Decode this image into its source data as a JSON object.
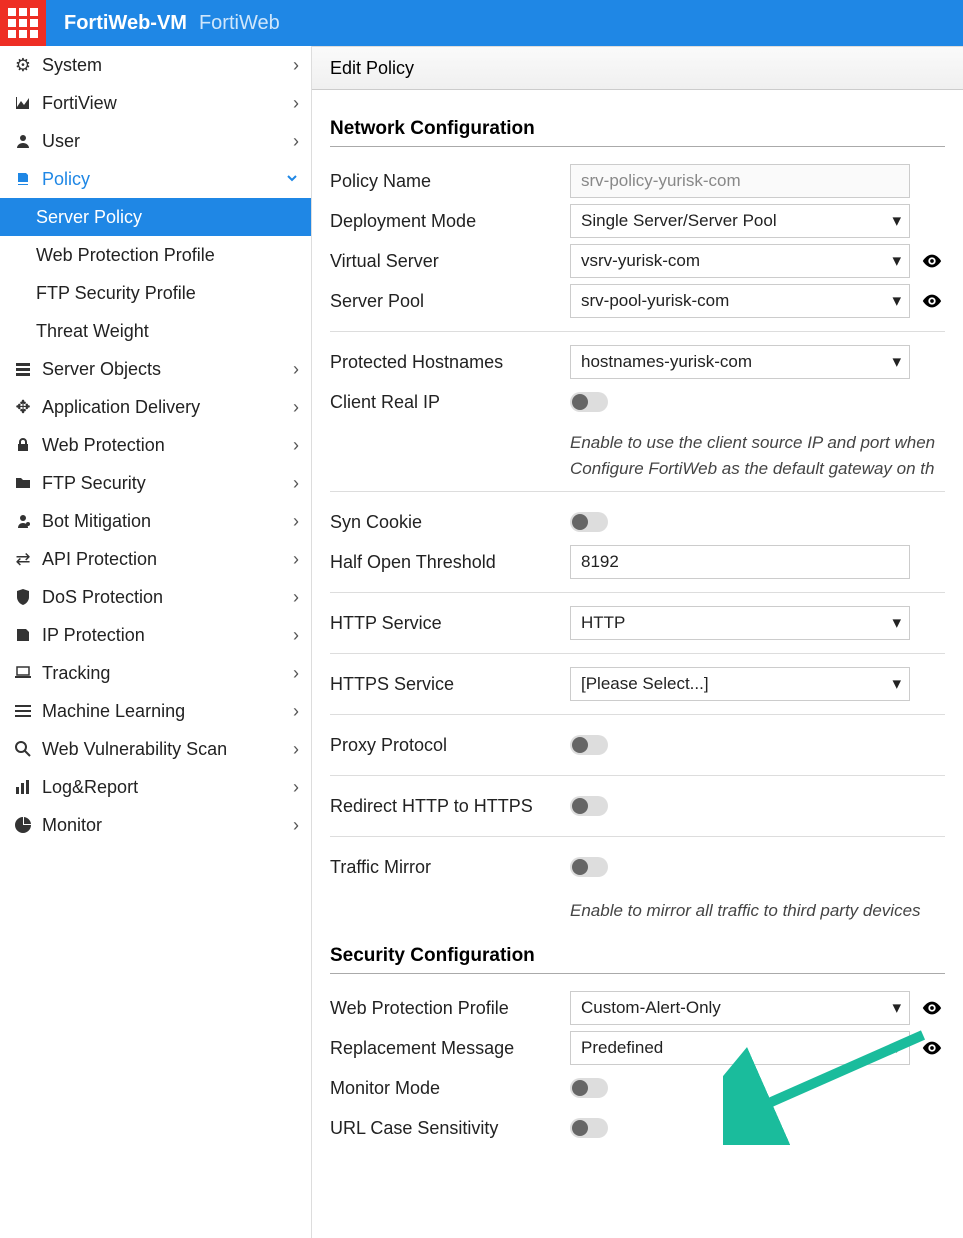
{
  "header": {
    "app": "FortiWeb-VM",
    "sub": "FortiWeb"
  },
  "sidebar": {
    "items": [
      {
        "label": "System",
        "icon": "gear"
      },
      {
        "label": "FortiView",
        "icon": "area"
      },
      {
        "label": "User",
        "icon": "user"
      },
      {
        "label": "Policy",
        "icon": "policy",
        "active": true,
        "expanded": true,
        "children": [
          {
            "label": "Server Policy",
            "selected": true
          },
          {
            "label": "Web Protection Profile"
          },
          {
            "label": "FTP Security Profile"
          },
          {
            "label": "Threat Weight"
          }
        ]
      },
      {
        "label": "Server Objects",
        "icon": "servers"
      },
      {
        "label": "Application Delivery",
        "icon": "move"
      },
      {
        "label": "Web Protection",
        "icon": "lock"
      },
      {
        "label": "FTP Security",
        "icon": "folder"
      },
      {
        "label": "Bot Mitigation",
        "icon": "bot"
      },
      {
        "label": "API Protection",
        "icon": "swap"
      },
      {
        "label": "DoS Protection",
        "icon": "shield"
      },
      {
        "label": "IP Protection",
        "icon": "ip"
      },
      {
        "label": "Tracking",
        "icon": "laptop"
      },
      {
        "label": "Machine Learning",
        "icon": "lines"
      },
      {
        "label": "Web Vulnerability Scan",
        "icon": "search"
      },
      {
        "label": "Log&Report",
        "icon": "bars"
      },
      {
        "label": "Monitor",
        "icon": "pie"
      }
    ]
  },
  "main": {
    "title": "Edit Policy",
    "section1": "Network Configuration",
    "section2": "Security Configuration",
    "fields": {
      "policy_name_label": "Policy Name",
      "policy_name_value": "srv-policy-yurisk-com",
      "deployment_mode_label": "Deployment Mode",
      "deployment_mode_value": "Single Server/Server Pool",
      "virtual_server_label": "Virtual Server",
      "virtual_server_value": "vsrv-yurisk-com",
      "server_pool_label": "Server Pool",
      "server_pool_value": "srv-pool-yurisk-com",
      "protected_hostnames_label": "Protected Hostnames",
      "protected_hostnames_value": "hostnames-yurisk-com",
      "client_real_ip_label": "Client Real IP",
      "client_real_ip_help": "Enable to use the client source IP and port when\nConfigure FortiWeb as the default gateway on th",
      "syn_cookie_label": "Syn Cookie",
      "half_open_label": "Half Open Threshold",
      "half_open_value": "8192",
      "http_service_label": "HTTP Service",
      "http_service_value": "HTTP",
      "https_service_label": "HTTPS Service",
      "https_service_value": "[Please Select...]",
      "proxy_protocol_label": "Proxy Protocol",
      "redirect_label": "Redirect HTTP to HTTPS",
      "traffic_mirror_label": "Traffic Mirror",
      "traffic_mirror_help": "Enable to mirror all traffic to third party devices",
      "web_protection_profile_label": "Web Protection Profile",
      "web_protection_profile_value": "Custom-Alert-Only",
      "replacement_message_label": "Replacement Message",
      "replacement_message_value": "Predefined",
      "monitor_mode_label": "Monitor Mode",
      "url_case_label": "URL Case Sensitivity"
    }
  }
}
